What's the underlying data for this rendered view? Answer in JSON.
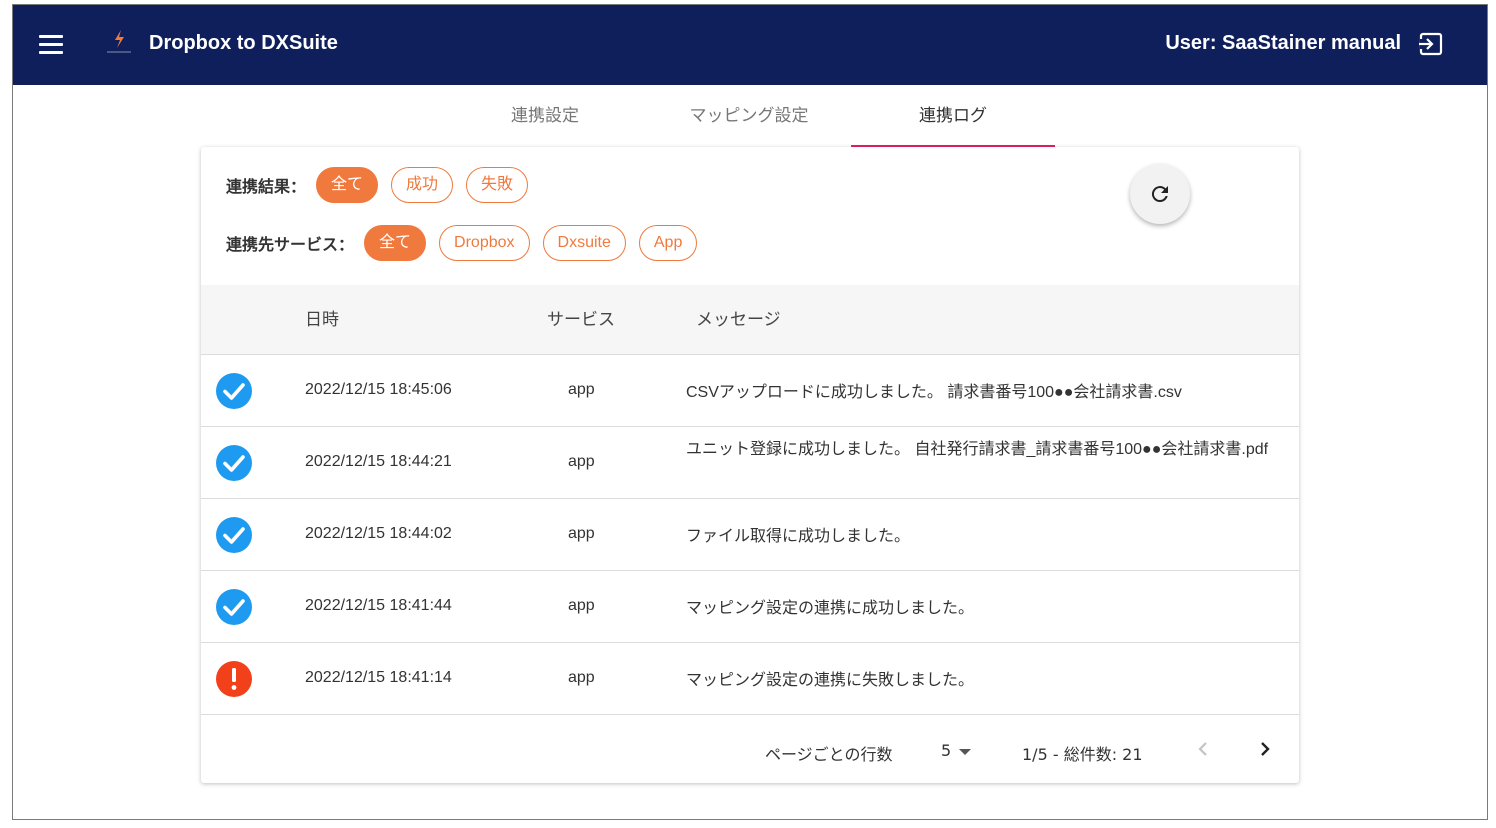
{
  "colors": {
    "appbar": "#0f1f5c",
    "accent_orange": "#f07a3e",
    "tab_indicator": "#e91e63",
    "success_blue": "#1e9bf0",
    "error_red": "#f2401b"
  },
  "header": {
    "menu_icon": "hamburger-menu-icon",
    "logo_icon": "lightning-logo-icon",
    "title": "Dropbox to DXSuite",
    "user_label": "User: SaaStainer manual",
    "logout_icon": "logout-icon"
  },
  "tabs": [
    {
      "label": "連携設定",
      "active": false
    },
    {
      "label": "マッピング設定",
      "active": false
    },
    {
      "label": "連携ログ",
      "active": true
    }
  ],
  "filters": {
    "result": {
      "label": "連携結果：",
      "chips": [
        {
          "label": "全て",
          "active": true
        },
        {
          "label": "成功",
          "active": false
        },
        {
          "label": "失敗",
          "active": false
        }
      ]
    },
    "service": {
      "label": "連携先サービス：",
      "chips": [
        {
          "label": "全て",
          "active": true
        },
        {
          "label": "Dropbox",
          "active": false
        },
        {
          "label": "Dxsuite",
          "active": false
        },
        {
          "label": "App",
          "active": false
        }
      ]
    },
    "refresh_icon": "refresh-icon"
  },
  "table": {
    "columns": [
      "日時",
      "サービス",
      "メッセージ"
    ],
    "rows": [
      {
        "status": "success",
        "datetime": "2022/12/15 18:45:06",
        "service": "app",
        "message": "CSVアップロードに成功しました。 請求書番号100●●会社請求書.csv"
      },
      {
        "status": "success",
        "datetime": "2022/12/15 18:44:21",
        "service": "app",
        "message": "ユニット登録に成功しました。 自社発行請求書_請求書番号100●●会社請求書.pdf"
      },
      {
        "status": "success",
        "datetime": "2022/12/15 18:44:02",
        "service": "app",
        "message": "ファイル取得に成功しました。"
      },
      {
        "status": "success",
        "datetime": "2022/12/15 18:41:44",
        "service": "app",
        "message": "マッピング設定の連携に成功しました。"
      },
      {
        "status": "error",
        "datetime": "2022/12/15 18:41:14",
        "service": "app",
        "message": "マッピング設定の連携に失敗しました。"
      }
    ]
  },
  "pagination": {
    "rows_per_page_label": "ページごとの行数",
    "rows_per_page": "5",
    "range": "1/5 - 総件数: 21",
    "prev_icon": "chevron-left-icon",
    "next_icon": "chevron-right-icon"
  }
}
